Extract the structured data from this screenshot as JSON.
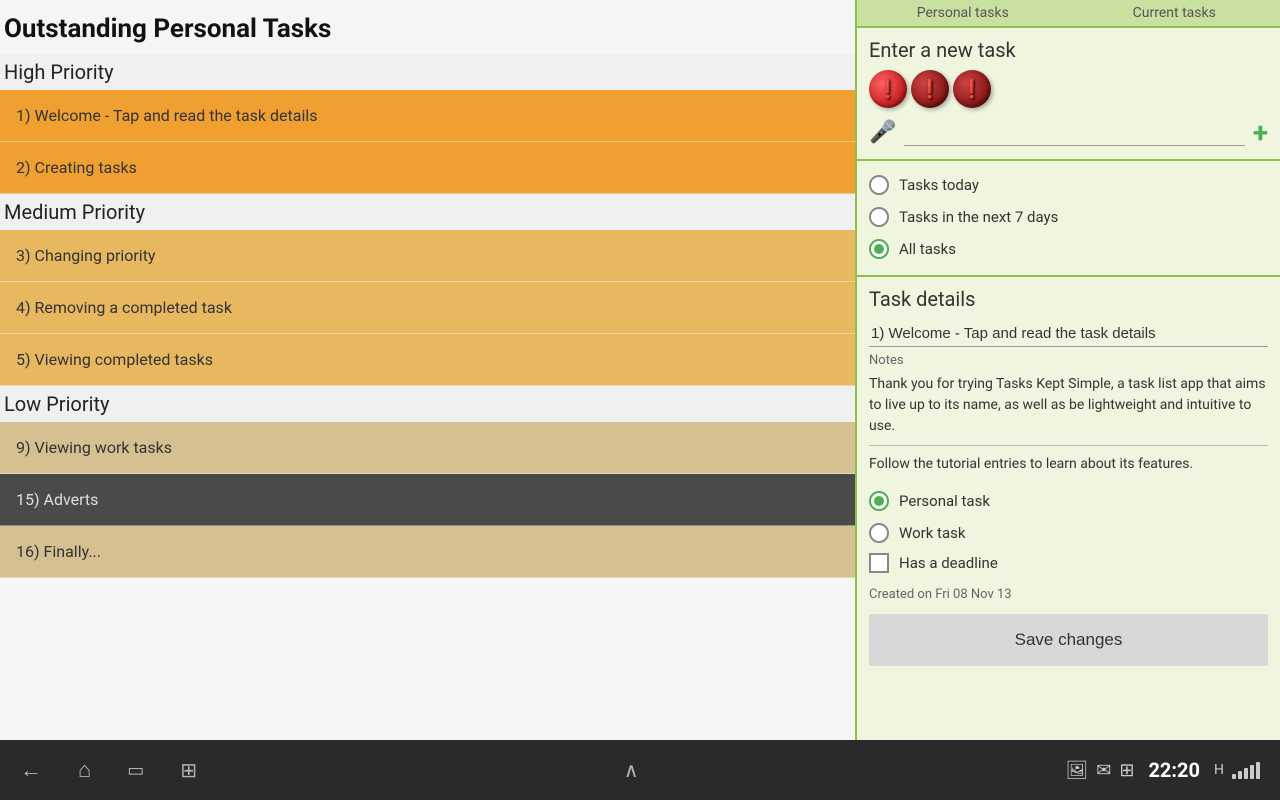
{
  "page": {
    "title": "Outstanding Personal Tasks"
  },
  "left_panel": {
    "sections": [
      {
        "label": "High Priority",
        "tasks": [
          {
            "id": 1,
            "text": "1) Welcome - Tap and read the task details",
            "priority": "high"
          },
          {
            "id": 2,
            "text": "2) Creating tasks",
            "priority": "high"
          }
        ]
      },
      {
        "label": "Medium Priority",
        "tasks": [
          {
            "id": 3,
            "text": "3) Changing priority",
            "priority": "medium"
          },
          {
            "id": 4,
            "text": "4) Removing a completed task",
            "priority": "medium"
          },
          {
            "id": 5,
            "text": "5) Viewing completed tasks",
            "priority": "medium"
          }
        ]
      },
      {
        "label": "Low Priority",
        "tasks": [
          {
            "id": 9,
            "text": "9) Viewing work tasks",
            "priority": "low"
          },
          {
            "id": 15,
            "text": "15) Adverts",
            "priority": "low-dark"
          },
          {
            "id": 16,
            "text": "16) Finally...",
            "priority": "low"
          }
        ]
      }
    ]
  },
  "right_panel": {
    "tabs": [
      {
        "label": "Personal tasks"
      },
      {
        "label": "Current tasks"
      }
    ],
    "new_task": {
      "title": "Enter a new task",
      "input_placeholder": "",
      "input_value": "",
      "add_label": "+"
    },
    "filters": {
      "options": [
        {
          "label": "Tasks today",
          "selected": false
        },
        {
          "label": "Tasks in the next 7 days",
          "selected": false
        },
        {
          "label": "All tasks",
          "selected": true
        }
      ]
    },
    "task_details": {
      "title": "Task details",
      "task_name": "1) Welcome - Tap and read the task details",
      "notes_label": "Notes",
      "notes_paragraph1": "Thank you for trying Tasks Kept Simple, a task list app that aims to live up to its name, as well as be lightweight and intuitive to use.",
      "notes_paragraph2": "Follow the tutorial entries to learn about its features.",
      "task_type_options": [
        {
          "label": "Personal task",
          "selected": true,
          "type": "radio"
        },
        {
          "label": "Work task",
          "selected": false,
          "type": "radio"
        },
        {
          "label": "Has a deadline",
          "selected": false,
          "type": "checkbox"
        }
      ],
      "created_on": "Created on Fri 08 Nov 13",
      "save_button": "Save changes"
    }
  },
  "bottom_nav": {
    "time": "22:20",
    "icons": {
      "back": "←",
      "home": "⌂",
      "recents": "▭",
      "scan": "⊞",
      "up": "∧"
    }
  }
}
